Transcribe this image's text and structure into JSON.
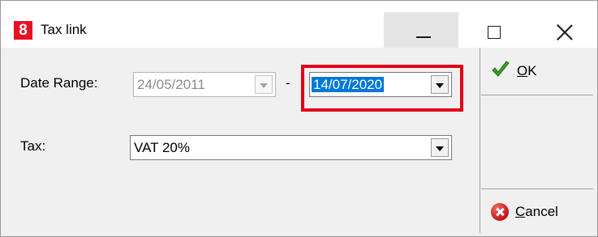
{
  "window": {
    "app_icon_glyph": "8",
    "title": "Tax link",
    "accent_color": "#e81123"
  },
  "form": {
    "date_range_label": "Date Range:",
    "date_from": "24/05/2011",
    "date_separator": "-",
    "date_to": "14/07/2020",
    "tax_label": "Tax:",
    "tax_value": "VAT 20%"
  },
  "buttons": {
    "ok_label": "OK",
    "cancel_label": "Cancel"
  },
  "icons": {
    "app": "app-logo-icon",
    "ok": "checkmark-icon",
    "cancel": "cancel-icon",
    "dropdown": "chevron-down-icon"
  },
  "colors": {
    "highlight_border": "#e2001a",
    "selection": "#0078d7"
  }
}
